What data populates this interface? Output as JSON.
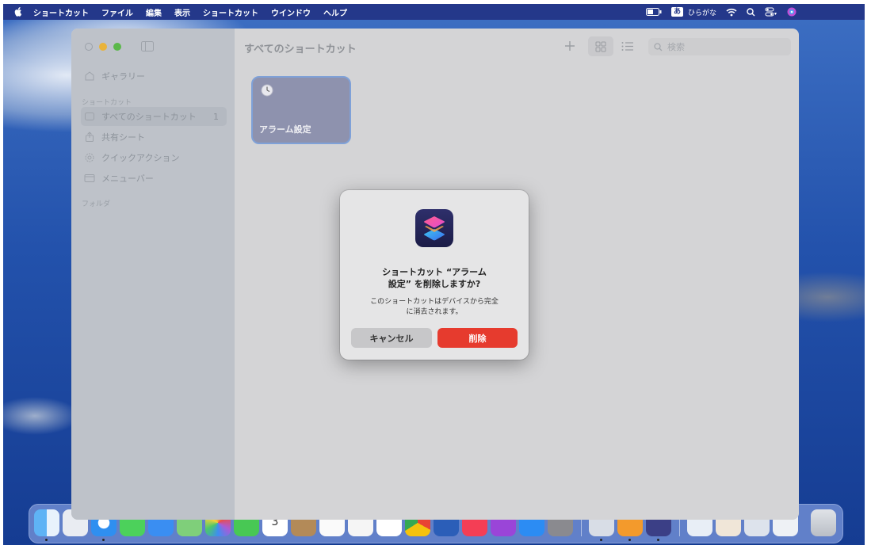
{
  "menubar": {
    "app_name": "ショートカット",
    "items": [
      "ファイル",
      "編集",
      "表示",
      "ショートカット",
      "ウインドウ",
      "ヘルプ"
    ],
    "ime_mark": "あ",
    "ime_label": "ひらがな"
  },
  "sidebar": {
    "gallery": "ギャラリー",
    "section_shortcuts": "ショートカット",
    "items": [
      {
        "label": "すべてのショートカット",
        "count": "1"
      },
      {
        "label": "共有シート"
      },
      {
        "label": "クイックアクション"
      },
      {
        "label": "メニューバー"
      }
    ],
    "section_folders": "フォルダ"
  },
  "main": {
    "title": "すべてのショートカット",
    "search_placeholder": "検索",
    "shortcut_card": {
      "label": "アラーム設定",
      "icon": "clock-icon"
    }
  },
  "dialog": {
    "title_line1": "ショートカット “アラーム",
    "title_line2": "設定” を削除しますか?",
    "message_line1": "このショートカットはデバイスから完全",
    "message_line2": "に消去されます。",
    "cancel_label": "キャンセル",
    "delete_label": "削除"
  },
  "dock": {
    "calendar_day": "3",
    "apps": [
      "finder",
      "launchpad",
      "safari",
      "messages",
      "mail",
      "maps",
      "photos",
      "facetime",
      "calendar",
      "contacts",
      "reminders",
      "notes",
      "freeform",
      "chrome",
      "word",
      "music",
      "podcasts",
      "app-store",
      "system-settings",
      "preview",
      "pages",
      "shortcuts",
      "downloads",
      "documents",
      "folder",
      "script",
      "trash"
    ]
  },
  "colors": {
    "accent_red": "#e63b2e",
    "card_bg": "#8e92ae",
    "menubar_bg": "#24388a"
  }
}
